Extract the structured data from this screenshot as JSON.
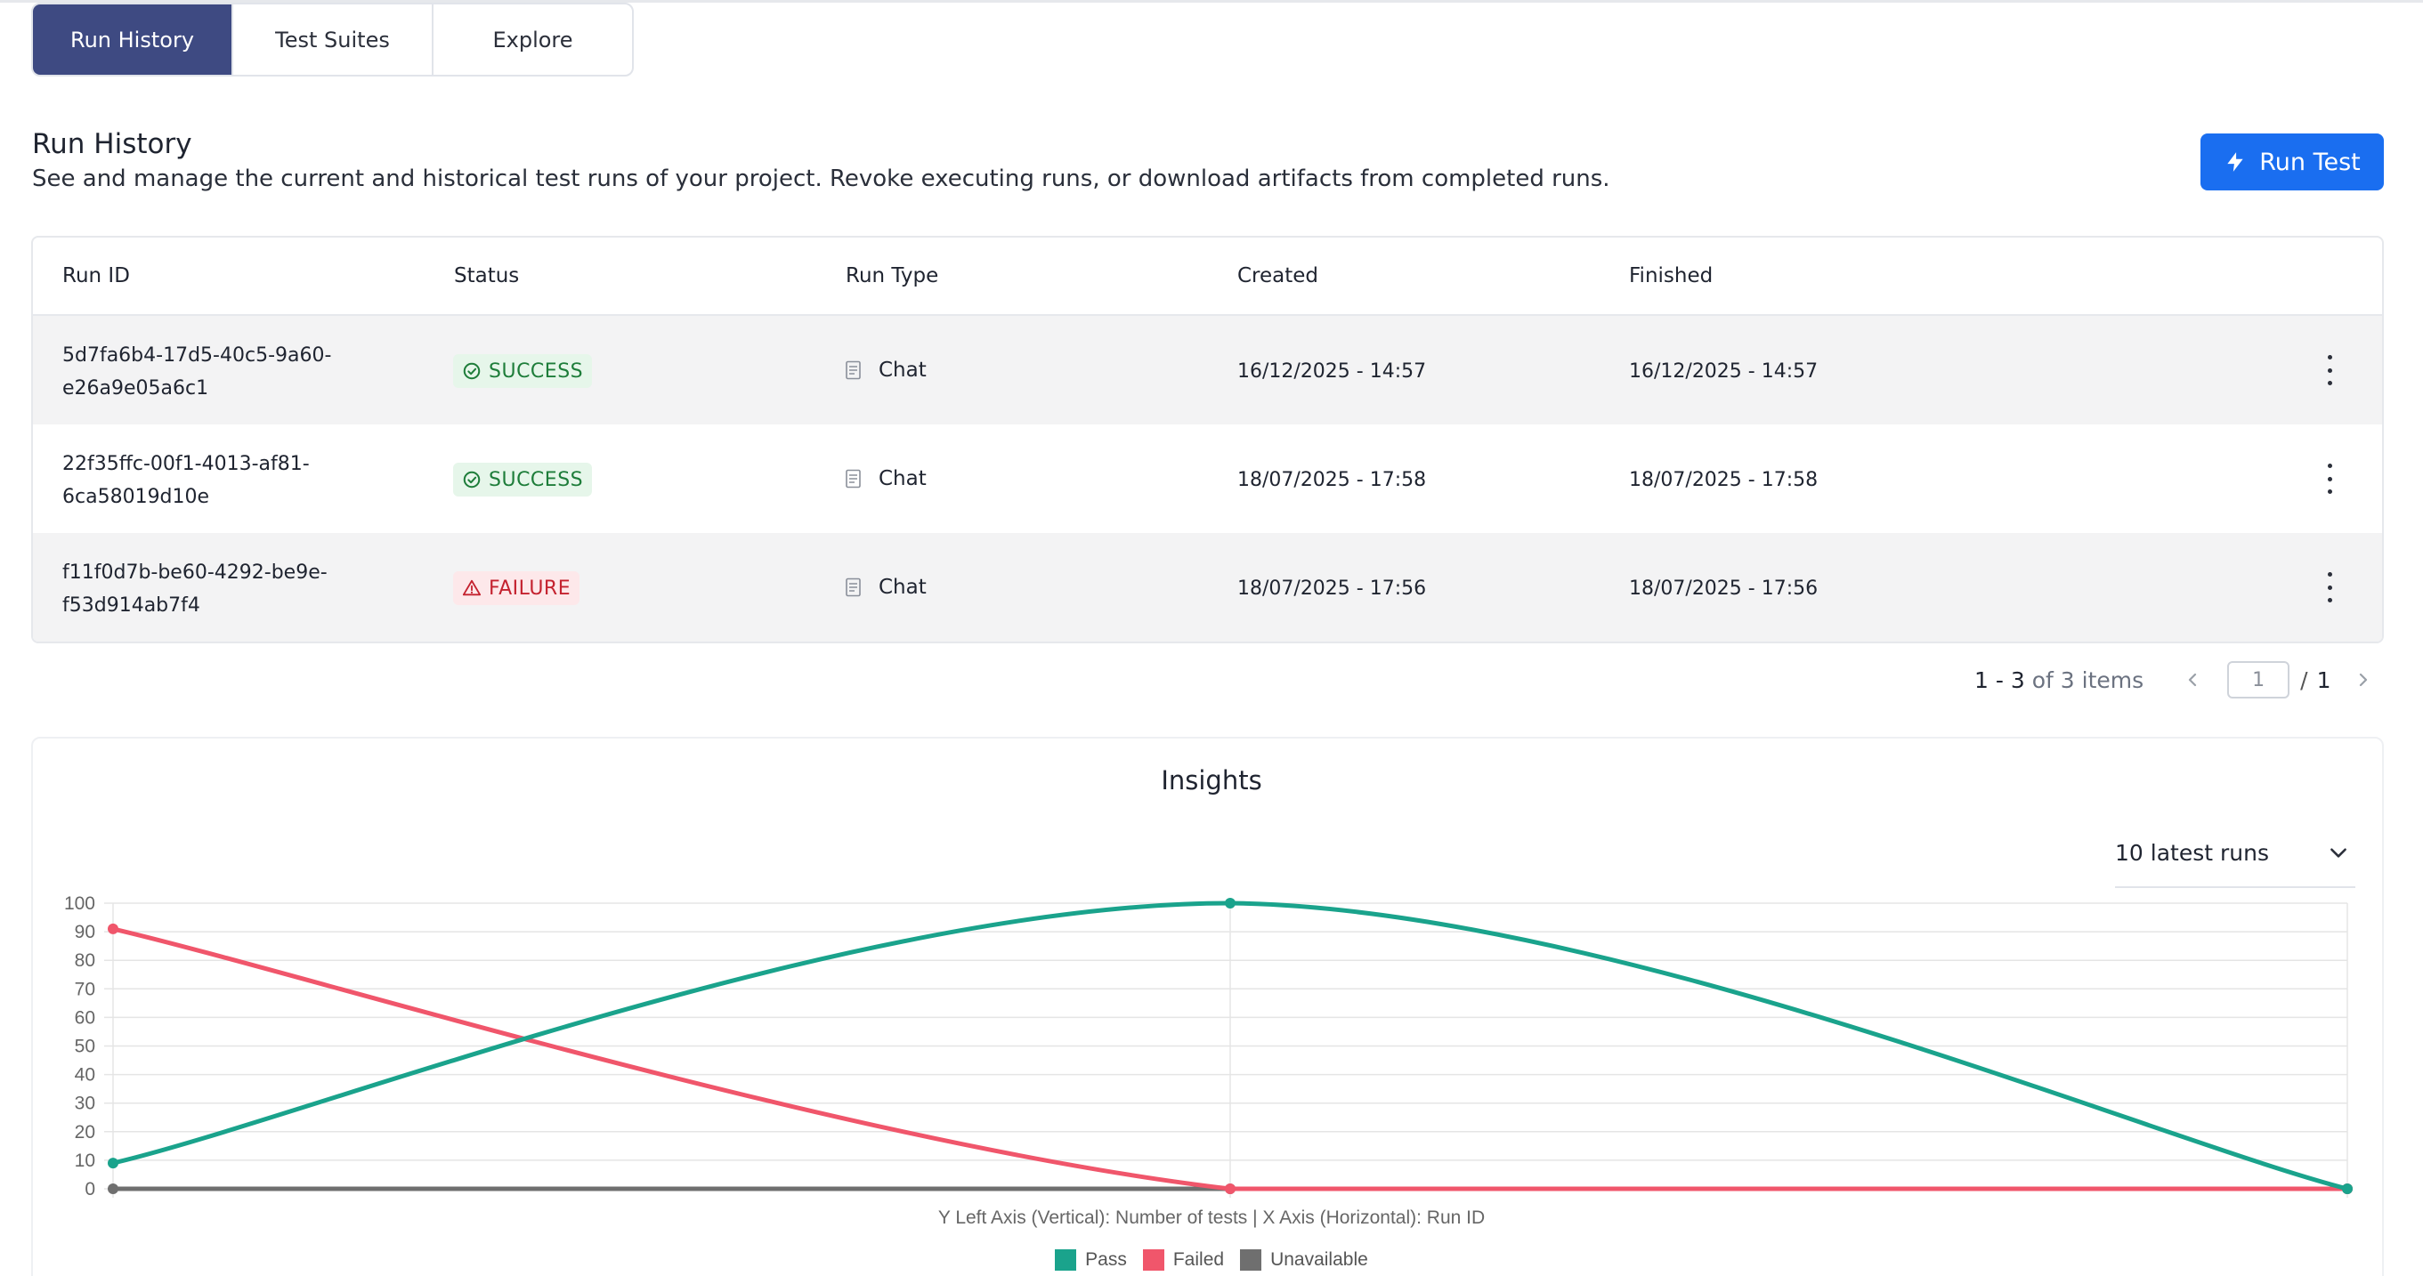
{
  "tabs": [
    {
      "label": "Run History",
      "active": true
    },
    {
      "label": "Test Suites",
      "active": false
    },
    {
      "label": "Explore",
      "active": false
    }
  ],
  "header": {
    "title": "Run History",
    "subtitle": "See and manage the current and historical test runs of your project. Revoke executing runs, or download artifacts from completed runs.",
    "run_button": "Run Test",
    "run_button_icon": "lightning-icon",
    "accent": "#1a6ef0"
  },
  "table": {
    "columns": [
      "Run ID",
      "Status",
      "Run Type",
      "Created",
      "Finished"
    ],
    "rows": [
      {
        "id_line1": "5d7fa6b4-17d5-40c5-9a60-",
        "id_line2": "e26a9e05a6c1",
        "status": "SUCCESS",
        "status_kind": "success",
        "type": "Chat",
        "created": "16/12/2025 - 14:57",
        "finished": "16/12/2025 - 14:57"
      },
      {
        "id_line1": "22f35ffc-00f1-4013-af81-",
        "id_line2": "6ca58019d10e",
        "status": "SUCCESS",
        "status_kind": "success",
        "type": "Chat",
        "created": "18/07/2025 - 17:58",
        "finished": "18/07/2025 - 17:58"
      },
      {
        "id_line1": "f11f0d7b-be60-4292-be9e-",
        "id_line2": "f53d914ab7f4",
        "status": "FAILURE",
        "status_kind": "failure",
        "type": "Chat",
        "created": "18/07/2025 - 17:56",
        "finished": "18/07/2025 - 17:56"
      }
    ]
  },
  "pagination": {
    "range": "1 - 3",
    "of_text": "of 3 items",
    "current_page": "1",
    "slash": "/",
    "total_pages": "1"
  },
  "insights": {
    "title": "Insights",
    "range_select": "10 latest runs"
  },
  "chart_data": {
    "type": "line",
    "x": [
      "f11f0d7b-be60-4292-be9e-f53d914ab7f4",
      "22f35ffc-00f1-4013-af81-6ca58019d10e",
      "5d7fa6b4-17d5-40c5-9a60-e26a9e05a6c1"
    ],
    "series": [
      {
        "name": "Pass",
        "color": "#1aa38c",
        "values": [
          9,
          100,
          0
        ]
      },
      {
        "name": "Failed",
        "color": "#f0566b",
        "values": [
          91,
          0,
          0
        ]
      },
      {
        "name": "Unavailable",
        "color": "#6f6f6f",
        "values": [
          0,
          0,
          0
        ]
      }
    ],
    "ylim": [
      0,
      100
    ],
    "yticks": [
      "0",
      "10",
      "20",
      "30",
      "40",
      "50",
      "60",
      "70",
      "80",
      "90",
      "100"
    ],
    "axis_caption": "Y Left Axis (Vertical): Number of tests  |  X Axis (Horizontal): Run ID",
    "grid": true,
    "legend_position": "bottom"
  }
}
